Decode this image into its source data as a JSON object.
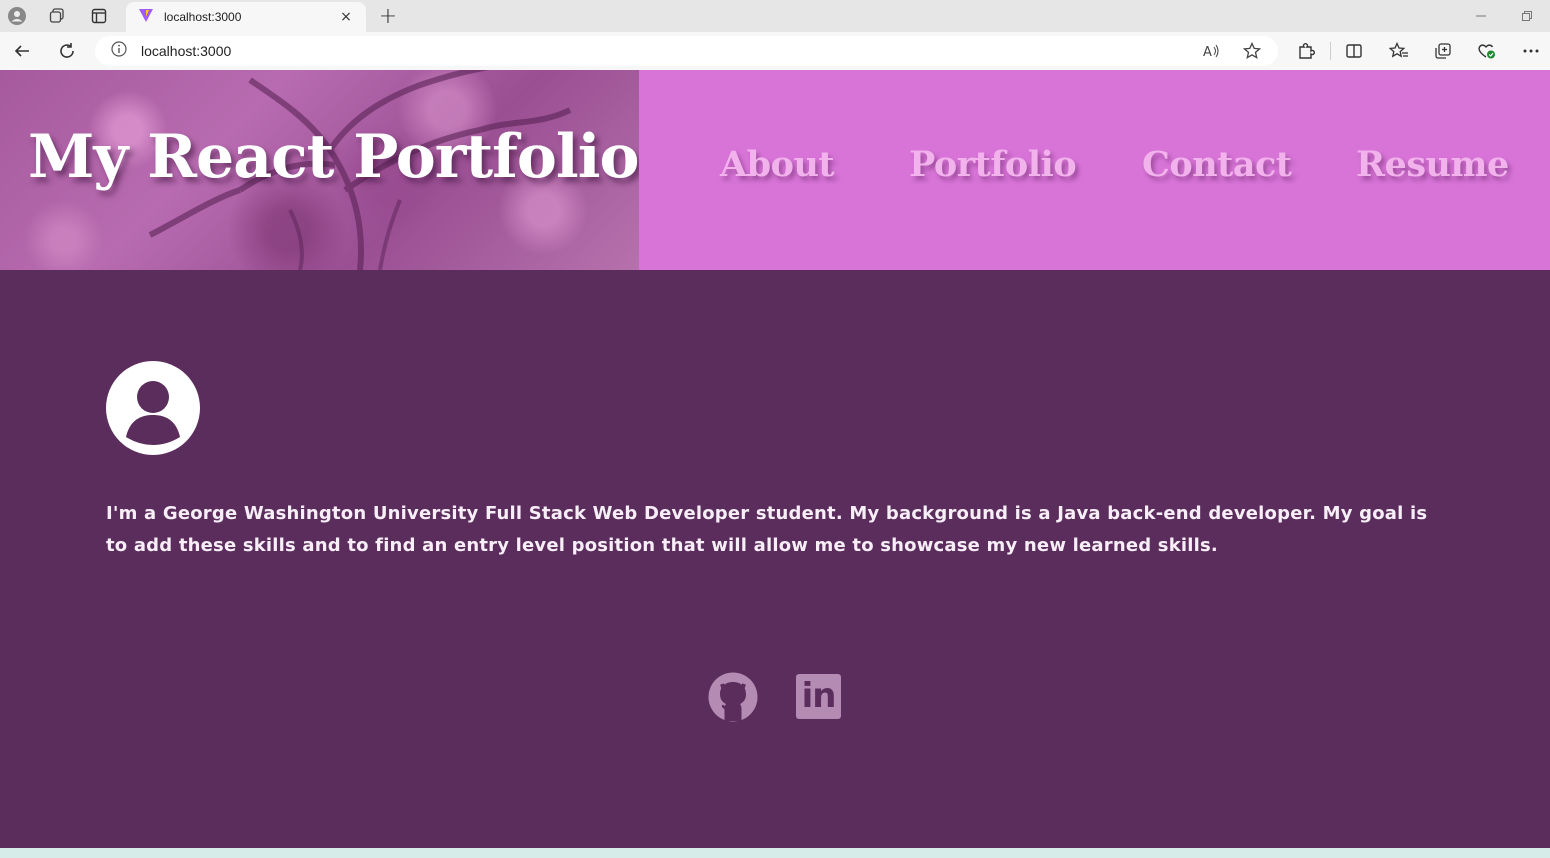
{
  "browser": {
    "tab_title": "localhost:3000",
    "url": "localhost:3000",
    "new_tab_symbol": "+",
    "close_tab_symbol": "×"
  },
  "header": {
    "title": "My React Portfolio",
    "nav": [
      {
        "label": "About"
      },
      {
        "label": "Portfolio"
      },
      {
        "label": "Contact"
      },
      {
        "label": "Resume"
      }
    ]
  },
  "about": {
    "avatar_icon": "user-circle-icon",
    "bio": "I'm a George Washington University Full Stack Web Developer student. My background is a Java back-end developer. My goal is to add these skills and to find an entry level position that will allow me to showcase my new learned skills."
  },
  "footer": {
    "links": [
      {
        "icon": "github-icon"
      },
      {
        "icon": "linkedin-icon",
        "label": "in"
      }
    ]
  },
  "colors": {
    "page_bg": "#5b2d5c",
    "nav_bg": "#d874d8",
    "nav_text": "#f2b2ec",
    "banner_tint": "#a65a9d",
    "icon_muted": "#b48bb3"
  }
}
